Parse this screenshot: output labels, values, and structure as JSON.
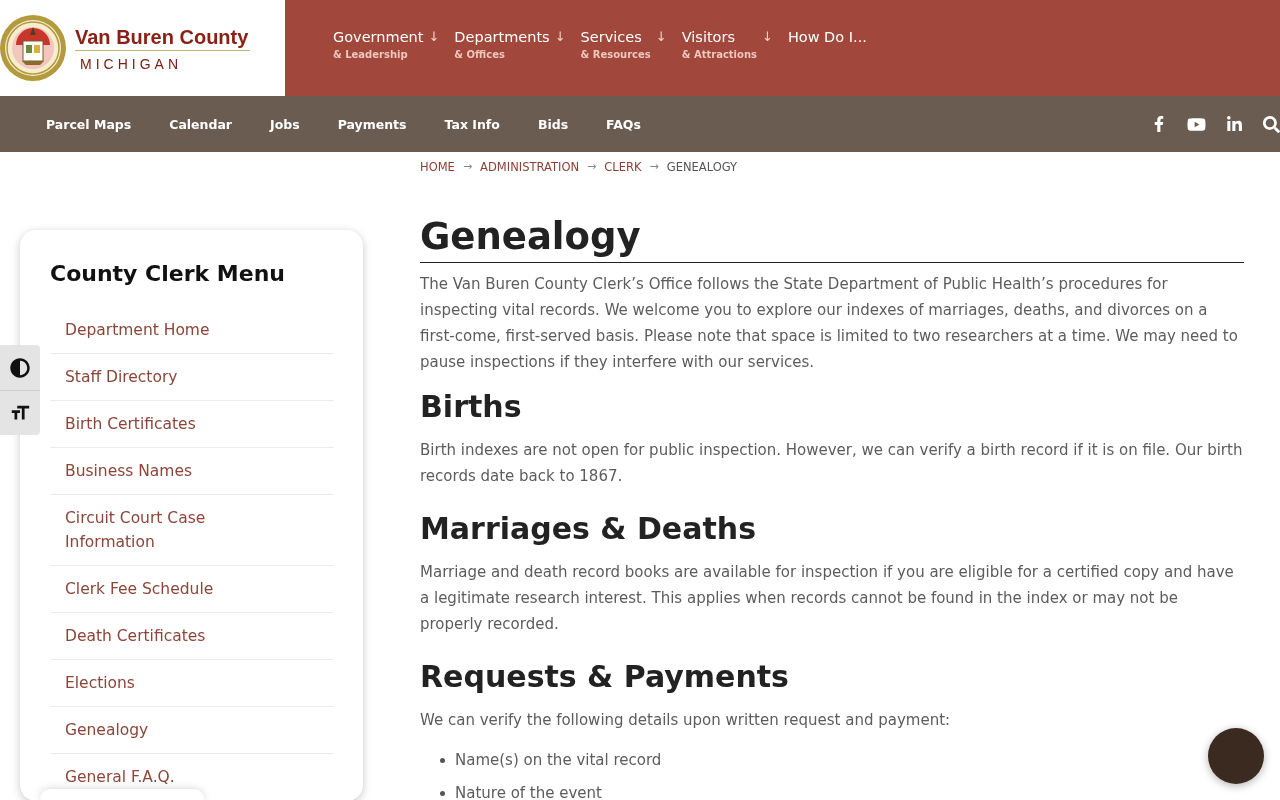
{
  "header": {
    "logo": {
      "title": "Van Buren County",
      "subtitle": "MICHIGAN"
    },
    "main_nav": [
      {
        "label": "Government",
        "sublabel": "& Leadership",
        "marker": "↓"
      },
      {
        "label": "Departments",
        "sublabel": "& Offices",
        "marker": "↓"
      },
      {
        "label": "Services",
        "sublabel": "& Resources",
        "marker": "↓"
      },
      {
        "label": "Visitors",
        "sublabel": "& Attractions",
        "marker": "↓"
      },
      {
        "label": "How Do I..."
      }
    ]
  },
  "quick_links": [
    "Parcel Maps",
    "Calendar",
    "Jobs",
    "Payments",
    "Tax Info",
    "Bids",
    "FAQs"
  ],
  "breadcrumb": [
    {
      "label": "HOME",
      "current": false
    },
    {
      "separator": "→",
      "label": "ADMINISTRATION",
      "current": false
    },
    {
      "separator": "→",
      "label": "CLERK",
      "current": false
    },
    {
      "separator": "→",
      "label": "GENEALOGY",
      "current": true
    }
  ],
  "sidebar": {
    "title": "County Clerk Menu",
    "items": [
      "Department Home",
      "Staff Directory",
      "Birth Certificates",
      "Business Names",
      "Circuit Court Case Information",
      "Clerk Fee Schedule",
      "Death Certificates",
      "Elections",
      "Genealogy",
      "General F.A.Q."
    ]
  },
  "content": {
    "title": "Genealogy",
    "blocks": [
      {
        "kind": "paragraph",
        "text": "The Van Buren County Clerk’s Office follows the State Department of Public Health’s procedures for inspecting vital records. We welcome you to explore our indexes of marriages, deaths, and divorces on a first-come, first-served basis. Please note that space is limited to two researchers at a time. We may need to pause inspections if they interfere with our services."
      },
      {
        "kind": "heading",
        "text": "Births"
      },
      {
        "kind": "paragraph",
        "text": "Birth indexes are not open for public inspection. However, we can verify a birth record if it is on file. Our birth records date back to 1867."
      },
      {
        "kind": "heading",
        "text": "Marriages & Deaths"
      },
      {
        "kind": "paragraph",
        "text": "Marriage and death record books are available for inspection if you are eligible for a certified copy and have a legitimate research interest. This applies when records cannot be found in the index or may not be properly recorded."
      },
      {
        "kind": "heading",
        "text": "Requests & Payments"
      },
      {
        "kind": "paragraph",
        "text": "We can verify the following details upon written request and payment:"
      },
      {
        "kind": "list",
        "items": [
          "Name(s) on the vital record",
          "Nature of the event"
        ]
      }
    ]
  }
}
